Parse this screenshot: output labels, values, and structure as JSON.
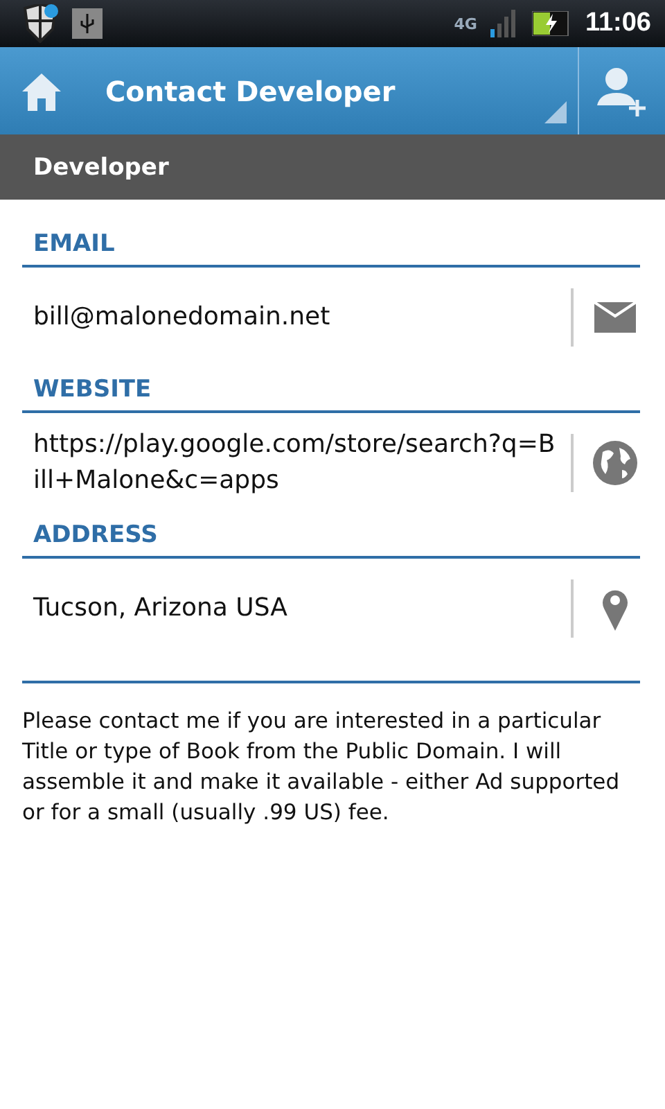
{
  "status_bar": {
    "network": "4G",
    "time": "11:06"
  },
  "action_bar": {
    "title": "Contact Developer"
  },
  "section": {
    "title": "Developer"
  },
  "fields": [
    {
      "kind": "email",
      "label": "EMAIL",
      "value": "bill@malonedomain.net"
    },
    {
      "kind": "website",
      "label": "WEBSITE",
      "value": "https://play.google.com/store/search?q=Bill+Malone&c=apps"
    },
    {
      "kind": "address",
      "label": "ADDRESS",
      "value": "Tucson, Arizona USA"
    }
  ],
  "description": "Please contact me if you are interested in a particular Title or type of Book from the Public Domain. I will assemble it and make it available - either Ad supported or for a small (usually .99 US) fee."
}
